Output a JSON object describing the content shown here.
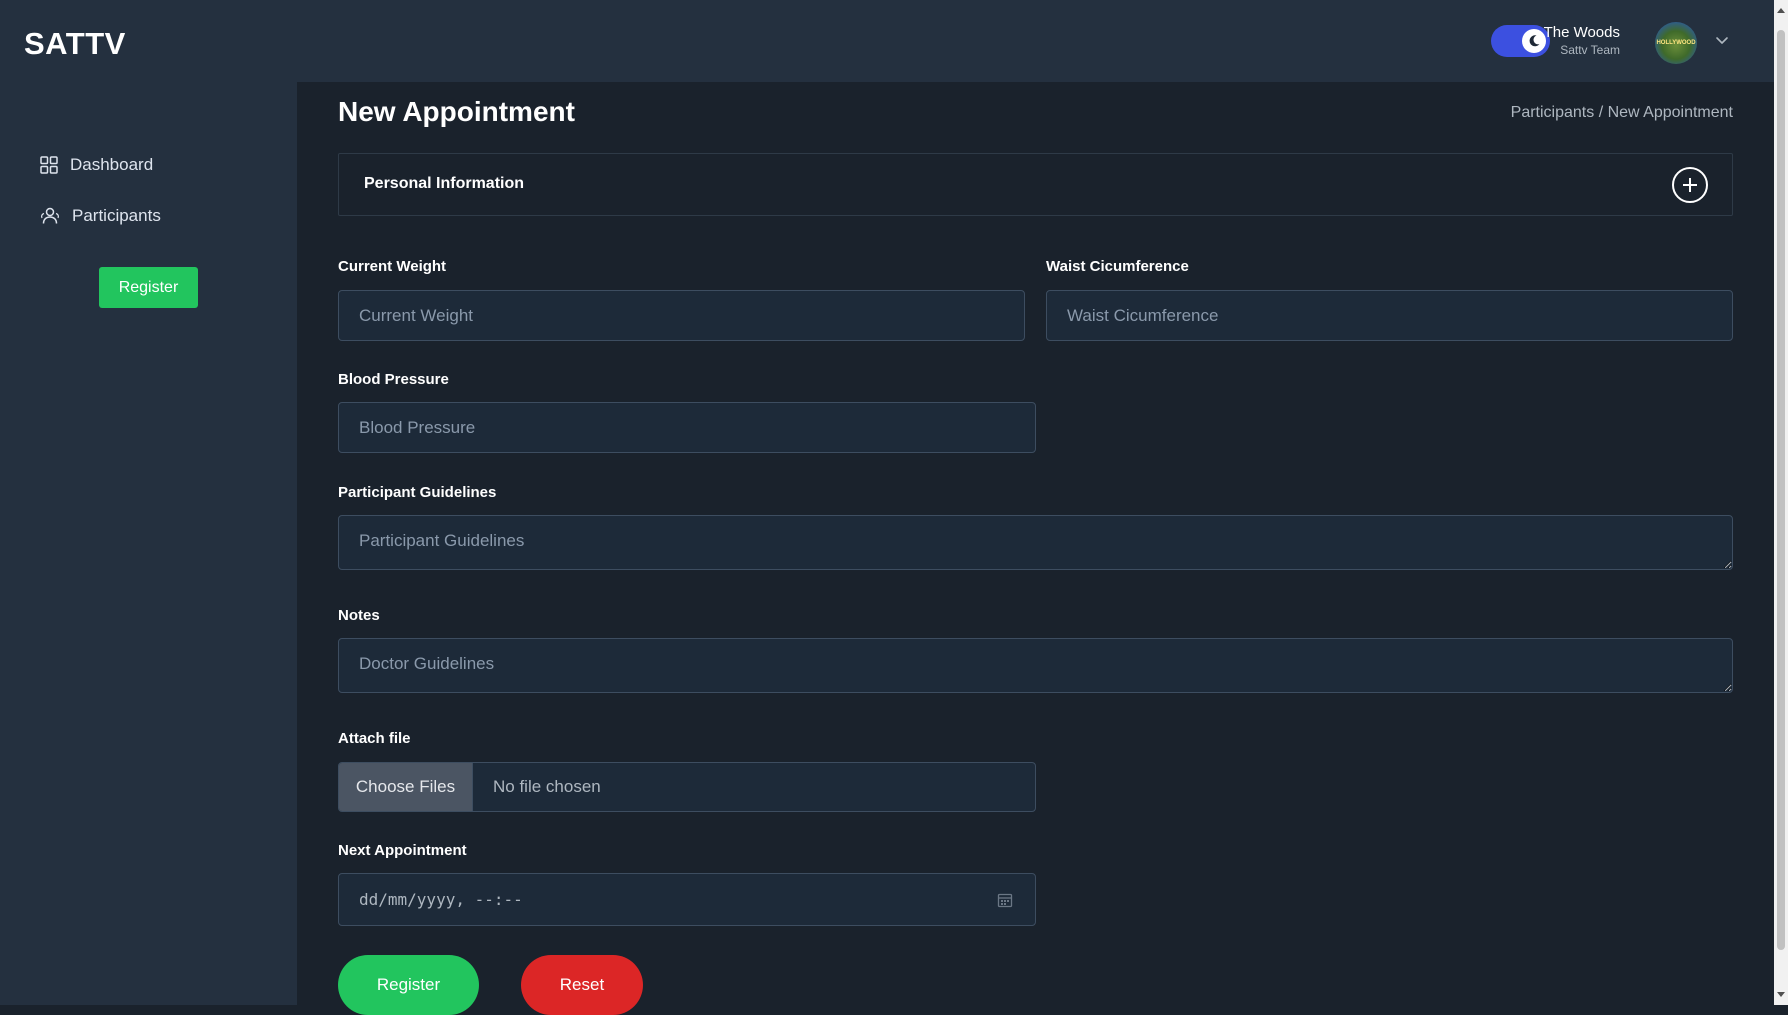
{
  "app": {
    "brand": "SATTV"
  },
  "header": {
    "theme_toggle_on": true,
    "user_name": "The Woods",
    "user_role": "Sattv Team",
    "avatar_text": "HOLLYWOOD"
  },
  "sidebar": {
    "items": [
      {
        "label": "Dashboard",
        "icon": "grid-icon"
      },
      {
        "label": "Participants",
        "icon": "users-icon"
      }
    ],
    "register_label": "Register"
  },
  "page": {
    "title": "New Appointment",
    "breadcrumb": {
      "parent": "Participants",
      "separator": " / ",
      "current": "New Appointment"
    }
  },
  "section": {
    "title": "Personal Information"
  },
  "form": {
    "current_weight": {
      "label": "Current Weight",
      "placeholder": "Current Weight",
      "value": ""
    },
    "waist": {
      "label": "Waist Cicumference",
      "placeholder": "Waist Cicumference",
      "value": ""
    },
    "blood_pressure": {
      "label": "Blood Pressure",
      "placeholder": "Blood Pressure",
      "value": ""
    },
    "guidelines": {
      "label": "Participant Guidelines",
      "placeholder": "Participant Guidelines",
      "value": ""
    },
    "notes": {
      "label": "Notes",
      "placeholder": "Doctor Guidelines",
      "value": ""
    },
    "attach": {
      "label": "Attach file",
      "button": "Choose Files",
      "status": "No file chosen"
    },
    "next_appointment": {
      "label": "Next Appointment",
      "placeholder": "dd/mm/yyyy, --:--"
    },
    "register_label": "Register",
    "reset_label": "Reset"
  },
  "colors": {
    "background": "#1a222c",
    "panel": "#24303f",
    "accent_toggle": "#3c50e0",
    "success": "#22c55e",
    "danger": "#dc2626"
  }
}
